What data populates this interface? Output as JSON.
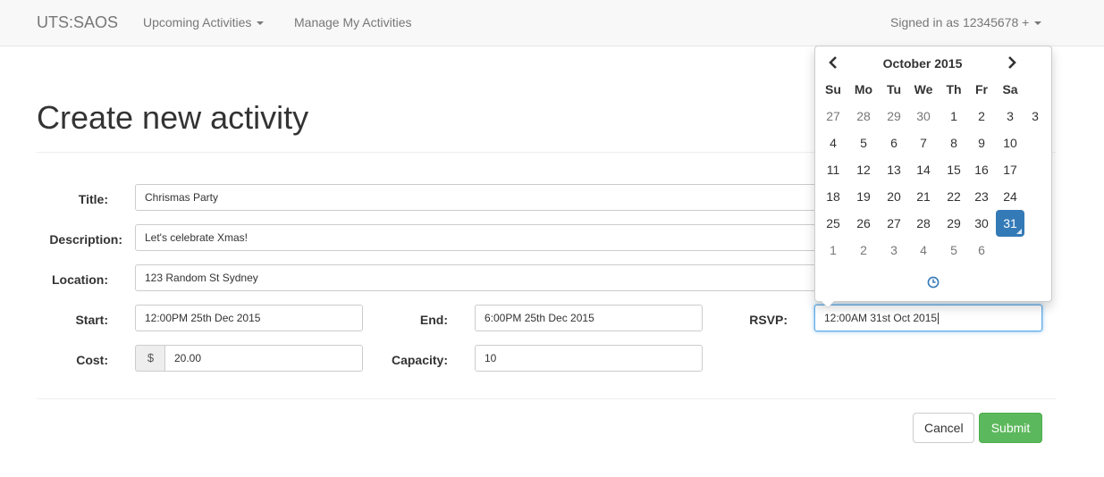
{
  "navbar": {
    "brand": "UTS:SAOS",
    "upcoming": "Upcoming Activities",
    "manage": "Manage My Activities",
    "signed_in": "Signed in as 12345678 +"
  },
  "page": {
    "title": "Create new activity"
  },
  "form": {
    "title_label": "Title:",
    "title_value": "Chrismas Party",
    "description_label": "Description:",
    "description_value": "Let's celebrate Xmas!",
    "location_label": "Location:",
    "location_value": "123 Random St Sydney",
    "start_label": "Start:",
    "start_value": "12:00PM 25th Dec 2015",
    "end_label": "End:",
    "end_value": "6:00PM 25th Dec 2015",
    "rsvp_label": "RSVP:",
    "rsvp_value": "12:00AM 31st Oct 2015",
    "cost_label": "Cost:",
    "cost_addon": "$",
    "cost_value": "20.00",
    "capacity_label": "Capacity:",
    "capacity_value": "10",
    "cancel_label": "Cancel",
    "submit_label": "Submit"
  },
  "datepicker": {
    "month": "October 2015",
    "prev_icon": "chevron-left-icon",
    "next_icon": "chevron-right-icon",
    "weekdays": [
      "Su",
      "Mo",
      "Tu",
      "We",
      "Th",
      "Fr",
      "Sa"
    ],
    "extra_week": "3",
    "weeks": [
      [
        {
          "d": "27",
          "old": true
        },
        {
          "d": "28",
          "old": true
        },
        {
          "d": "29",
          "old": true
        },
        {
          "d": "30",
          "old": true
        },
        {
          "d": "1"
        },
        {
          "d": "2"
        },
        {
          "d": "3"
        }
      ],
      [
        {
          "d": "4"
        },
        {
          "d": "5"
        },
        {
          "d": "6"
        },
        {
          "d": "7"
        },
        {
          "d": "8"
        },
        {
          "d": "9"
        },
        {
          "d": "10"
        }
      ],
      [
        {
          "d": "11"
        },
        {
          "d": "12"
        },
        {
          "d": "13"
        },
        {
          "d": "14"
        },
        {
          "d": "15"
        },
        {
          "d": "16"
        },
        {
          "d": "17"
        }
      ],
      [
        {
          "d": "18"
        },
        {
          "d": "19"
        },
        {
          "d": "20"
        },
        {
          "d": "21"
        },
        {
          "d": "22"
        },
        {
          "d": "23"
        },
        {
          "d": "24"
        }
      ],
      [
        {
          "d": "25"
        },
        {
          "d": "26"
        },
        {
          "d": "27"
        },
        {
          "d": "28"
        },
        {
          "d": "29"
        },
        {
          "d": "30"
        },
        {
          "d": "31",
          "active": true
        }
      ],
      [
        {
          "d": "1",
          "old": true
        },
        {
          "d": "2",
          "old": true
        },
        {
          "d": "3",
          "old": true
        },
        {
          "d": "4",
          "old": true
        },
        {
          "d": "5",
          "old": true
        },
        {
          "d": "6",
          "old": true
        }
      ]
    ],
    "clock_icon": "clock-icon"
  },
  "colors": {
    "accent": "#337ab7",
    "success": "#5cb85c",
    "focus": "#66afe9"
  }
}
